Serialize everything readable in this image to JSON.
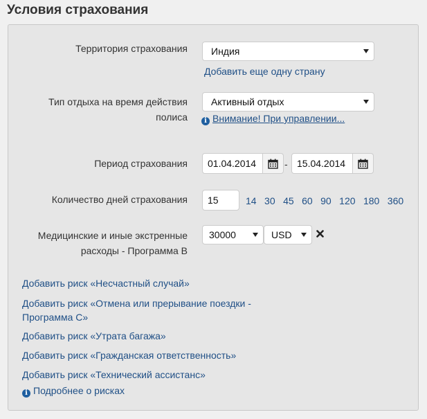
{
  "title": "Условия страхования",
  "territory": {
    "label": "Территория страхования",
    "value": "Индия",
    "add_country_link": "Добавить еще одну страну"
  },
  "vacation_type": {
    "label_line1": "Тип отдыха на время действия",
    "label_line2": "полиса",
    "value": "Активный отдых",
    "warning_link": "Внимание! При управлении..."
  },
  "period": {
    "label": "Период страхования",
    "start": "01.04.2014",
    "separator": "-",
    "end": "15.04.2014"
  },
  "days": {
    "label": "Количество дней страхования",
    "value": "15",
    "presets": [
      "14",
      "30",
      "45",
      "60",
      "90",
      "120",
      "180",
      "360"
    ]
  },
  "medical": {
    "label_line1": "Медицинские и иные экстренные",
    "label_line2": "расходы - Программа В",
    "amount": "30000",
    "currency": "USD"
  },
  "risks": {
    "accident": "Добавить риск «Несчастный случай»",
    "cancel_line1": "Добавить риск «Отмена или прерывание поездки -",
    "cancel_line2": "Программа С»",
    "baggage": "Добавить риск «Утрата багажа»",
    "liability": "Добавить риск «Гражданская ответственность»",
    "assistance": "Добавить риск «Технический ассистанс»",
    "more_link": "Подробнее о рисках"
  }
}
